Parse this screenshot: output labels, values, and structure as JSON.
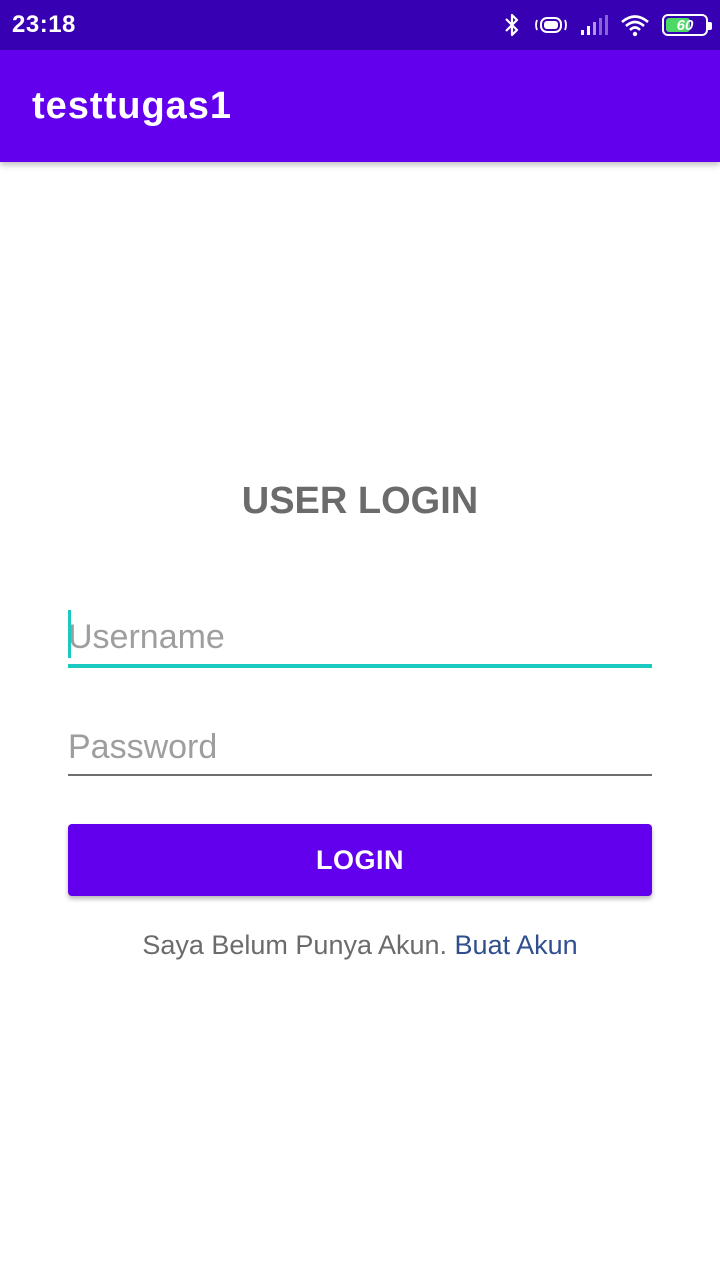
{
  "status_bar": {
    "time": "23:18",
    "icons": [
      "bluetooth-icon",
      "vibrate-icon",
      "signal-icon",
      "wifi-icon",
      "battery-icon"
    ],
    "battery_level": "60"
  },
  "app_bar": {
    "title": "testtugas1",
    "color": "#6200ee"
  },
  "login": {
    "title": "USER LOGIN",
    "username_placeholder": "Username",
    "username_value": "",
    "password_placeholder": "Password",
    "password_value": "",
    "button_label": "LOGIN",
    "signup_prompt": "Saya Belum Punya Akun.",
    "signup_link": "Buat Akun"
  },
  "colors": {
    "status_bar": "#3700b3",
    "primary": "#6200ee",
    "accent": "#1ac9c0",
    "link": "#2f4f8f"
  }
}
